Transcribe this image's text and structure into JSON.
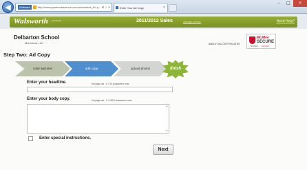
{
  "browser": {
    "back_icon": "back-arrow-icon",
    "address_badge": "Software",
    "address_url": "http://www.yearbookavenue.com/orders/ads_Ed  ρ ‒ ☒ ☆ ✕",
    "tab_title": "Enter Your Ad Copy",
    "tab_close": "×",
    "window_controls": {
      "minimize": "‒",
      "maximize": "□",
      "close": "✕"
    }
  },
  "header": {
    "logo": "Walsworth",
    "logo_sub": "yearbooks",
    "title": "2011/2012 Sales",
    "title_link": "change school",
    "help_link": "Need Help?"
  },
  "school": {
    "name": "Delbarton School",
    "city": "Morristown, NJ"
  },
  "about_link": "ABOUT SSL CERTIFICATES",
  "security_badge": {
    "brand": "McAfee",
    "label": "SECURE",
    "tested": "TESTED",
    "date": "21-NOV",
    "color": "#c8102e"
  },
  "step_title": "Step Two: Ad Copy",
  "steps": [
    {
      "label": "color and size",
      "state": "done"
    },
    {
      "label": "add copy",
      "state": "current"
    },
    {
      "label": "upload photos",
      "state": "todo"
    },
    {
      "label": "finish",
      "state": "todo"
    }
  ],
  "headline": {
    "label": "Enter your headline.",
    "hint": "full page ad : 0 / 40 characters max",
    "value": ""
  },
  "body_copy": {
    "label": "Enter your body copy.",
    "hint": "full page ad : 0 / 2600 characters max",
    "value": "",
    "scroll_up": "▲",
    "scroll_down": "▼"
  },
  "special_instructions": {
    "label": "Enter special instructions.",
    "checked": false
  },
  "next_button": "Next",
  "colors": {
    "header_green": "#8aa02c",
    "current_step": "#4f8fcf",
    "finish_badge": "#8bb636"
  }
}
